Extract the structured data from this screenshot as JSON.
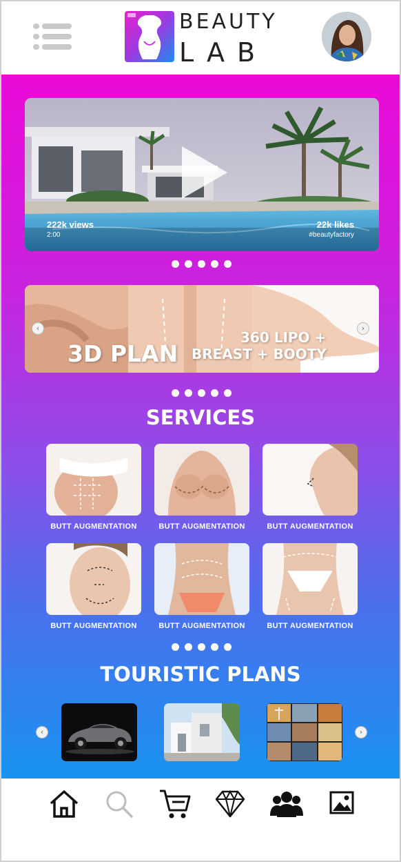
{
  "header": {
    "brand_line1": "BEAUTY",
    "brand_line2": "LAB",
    "menu_icon": "hamburger-list-icon",
    "avatar": "user-avatar"
  },
  "video": {
    "views": "222k views",
    "duration": "2:00",
    "likes": "22k likes",
    "hashtag": "#beautyfactory",
    "icon": "play-icon"
  },
  "banner": {
    "title": "3D PLAN",
    "line1": "360 LIPO +",
    "line2": "BREAST + BOOTY"
  },
  "services": {
    "title": "SERVICES",
    "items": [
      {
        "label": "BUTT  AUGMENTATION"
      },
      {
        "label": "BUTT  AUGMENTATION"
      },
      {
        "label": "BUTT  AUGMENTATION"
      },
      {
        "label": "BUTT  AUGMENTATION"
      },
      {
        "label": "BUTT  AUGMENTATION"
      },
      {
        "label": "BUTT  AUGMENTATION"
      }
    ]
  },
  "touristic": {
    "title": "TOURISTIC PLANS",
    "items": [
      "car",
      "house",
      "city-collage"
    ]
  },
  "nav": {
    "items": [
      "home-icon",
      "search-icon",
      "cart-icon",
      "diamond-icon",
      "group-icon",
      "gallery-icon"
    ]
  },
  "colors": {
    "gradient_top": "#ea0ad6",
    "gradient_bottom": "#1893f0",
    "accent_text": "#ffffff"
  }
}
